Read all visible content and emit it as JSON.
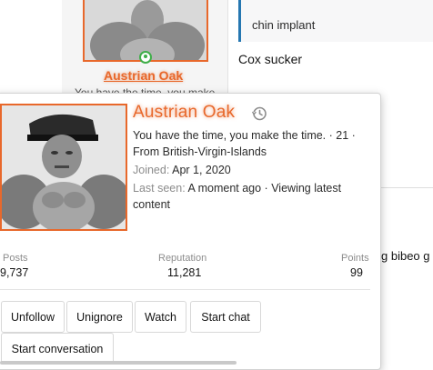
{
  "background": {
    "username": "Austrian Oak",
    "user_title": "You have the time, you make",
    "quote_text": "chin implant",
    "message_text": "Cox sucker",
    "tail_text": "g bibeo g"
  },
  "card": {
    "username": "Austrian Oak",
    "blurb_line": "You have the time, you make the time. · 21 · From British-Virgin-Islands",
    "joined_label": "Joined:",
    "joined_value": "Apr 1, 2020",
    "last_seen_label": "Last seen:",
    "last_seen_value": "A moment ago · Viewing latest content",
    "stats": {
      "posts_label": "Posts",
      "posts_value": "9,737",
      "reputation_label": "Reputation",
      "reputation_value": "11,281",
      "points_label": "Points",
      "points_value": "99"
    },
    "buttons": {
      "unfollow": "Unfollow",
      "unignore": "Unignore",
      "watch": "Watch",
      "start_chat": "Start chat",
      "start_conversation": "Start conversation"
    }
  },
  "colors": {
    "username": "#e8682b",
    "online": "#3fae49",
    "quote_border": "#2577b1"
  },
  "icons": [
    "online-status-icon",
    "history-icon"
  ]
}
